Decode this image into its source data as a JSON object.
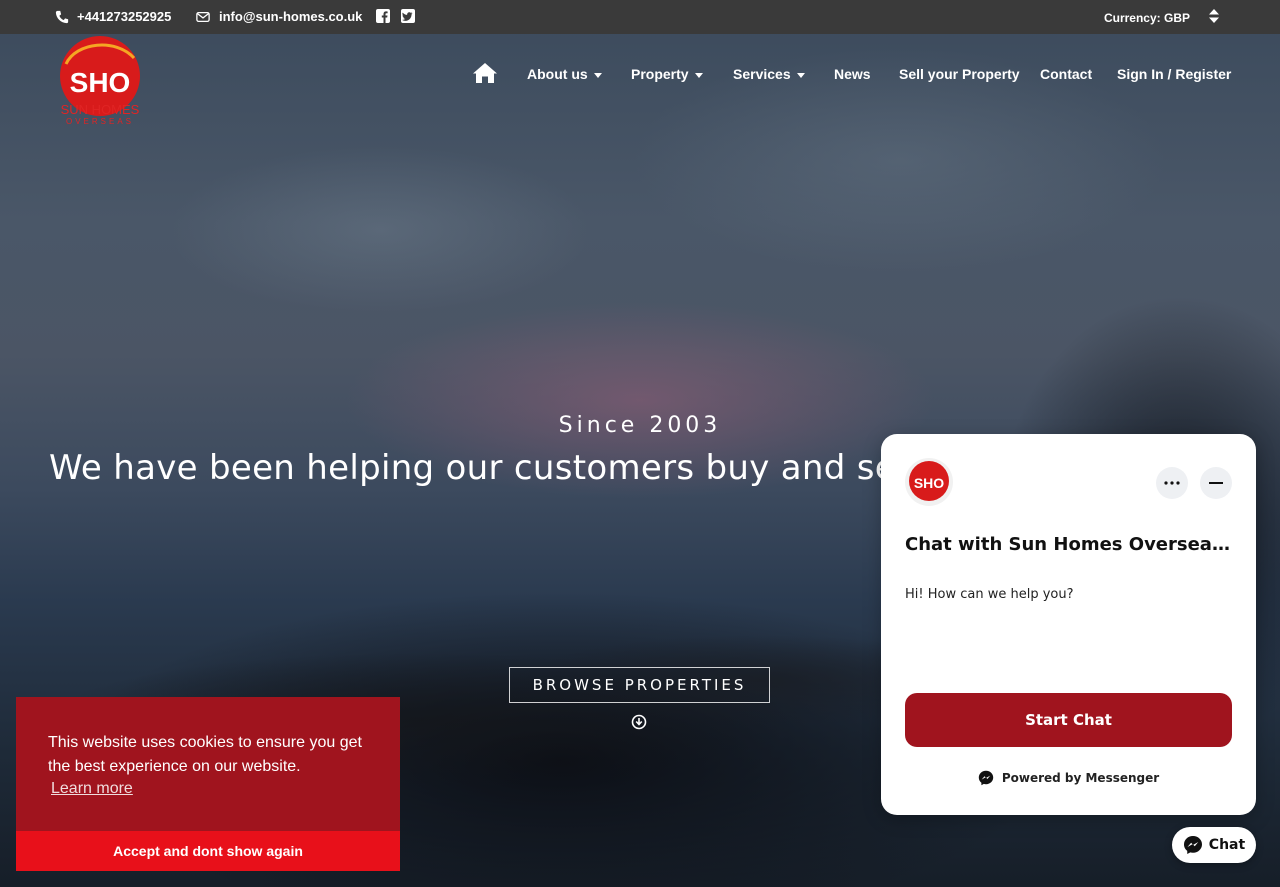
{
  "topbar": {
    "phone": "+441273252925",
    "email": "info@sun-homes.co.uk",
    "social_icons": [
      "facebook-icon",
      "twitter-icon"
    ],
    "currency_label": "Currency: GBP"
  },
  "logo": {
    "mark": "SHO",
    "line1": "SUN HOMES",
    "line2": "OVERSEAS"
  },
  "nav": {
    "home_icon": "home-icon",
    "items": [
      {
        "label": "About us",
        "dropdown": true
      },
      {
        "label": "Property",
        "dropdown": true
      },
      {
        "label": "Services",
        "dropdown": true
      },
      {
        "label": "News",
        "dropdown": false
      },
      {
        "label": "Sell your Property",
        "dropdown": false
      },
      {
        "label": "Contact",
        "dropdown": false
      },
      {
        "label": "Sign In / Register",
        "dropdown": false
      }
    ]
  },
  "hero": {
    "since": "Since 2003",
    "headline": "We have been helping our customers buy and sell",
    "browse_label": "BROWSE PROPERTIES"
  },
  "cookie": {
    "text": "This website uses cookies to ensure you get the best experience on our website.",
    "learn_more": "Learn more",
    "accept_label": "Accept and dont show again"
  },
  "chat": {
    "title": "Chat with Sun Homes Overseas ...",
    "greeting": "Hi! How can we help you?",
    "start_label": "Start Chat",
    "powered_by": "Powered by Messenger",
    "fab_label": "Chat"
  },
  "colors": {
    "brand_red": "#a0141e",
    "accept_red": "#e8101a",
    "topbar": "#3a3a3a"
  }
}
